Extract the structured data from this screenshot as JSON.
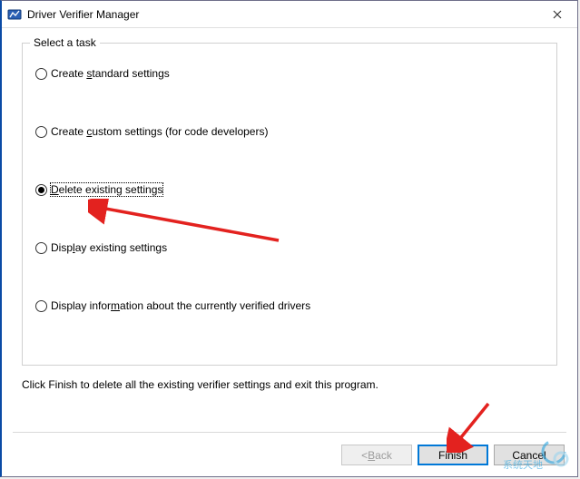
{
  "window": {
    "title": "Driver Verifier Manager"
  },
  "group": {
    "legend": "Select a task"
  },
  "options": {
    "o1_pre": "Create ",
    "o1_ul": "s",
    "o1_post": "tandard settings",
    "o2_pre": "Create ",
    "o2_ul": "c",
    "o2_post": "ustom settings (for code developers)",
    "o3_pre": "",
    "o3_ul": "D",
    "o3_post": "elete existing settings",
    "o4_pre": "Disp",
    "o4_ul": "l",
    "o4_post": "ay existing settings",
    "o5_pre": "Display infor",
    "o5_ul": "m",
    "o5_post": "ation about the currently verified drivers"
  },
  "instruction": "Click Finish to delete all the existing verifier settings and exit this program.",
  "buttons": {
    "back_pre": "< ",
    "back_ul": "B",
    "back_post": "ack",
    "finish": "Finish",
    "cancel": "Cancel"
  },
  "watermark": {
    "text": "系统天地"
  }
}
